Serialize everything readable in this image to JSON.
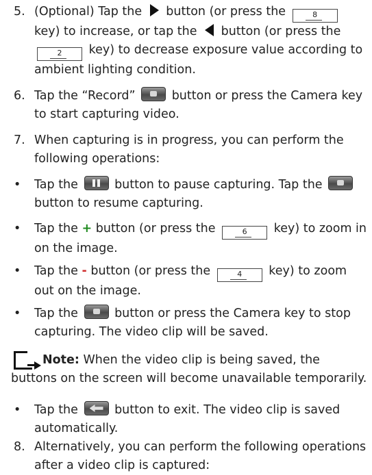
{
  "items": {
    "step5": {
      "num": "5.",
      "t1": "(Optional) Tap the",
      "t2": "button (or press the",
      "key_inc": "8",
      "t3": "key) to increase, or tap the",
      "t4": "button (or press the",
      "key_dec": "2",
      "t5": "key) to decrease exposure value according to ambient lighting condition."
    },
    "step6": {
      "num": "6.",
      "t1": "Tap the “Record”",
      "t2": "button or press the Camera key to start capturing video."
    },
    "step7": {
      "num": "7.",
      "text": "When capturing is in progress, you can perform the following operations:"
    },
    "bullet_pause": {
      "t1": "Tap the",
      "t2": "button to pause capturing. Tap the",
      "t3": "button to resume capturing."
    },
    "bullet_zoom_in": {
      "t1": "Tap the",
      "sym": "+",
      "t2": "button (or press the",
      "key": "6",
      "t3": "key) to zoom in on the image."
    },
    "bullet_zoom_out": {
      "t1": "Tap the",
      "sym": "-",
      "t2": "button (or press the",
      "key": "4",
      "t3": "key) to zoom out on the image."
    },
    "bullet_stop": {
      "t1": "Tap the",
      "t2": "button or press the Camera key to stop capturing. The video clip will be saved."
    },
    "note": {
      "label": "Note:",
      "text": "When the video clip is being saved, the buttons on the screen will become unavailable temporarily."
    },
    "bullet_exit": {
      "t1": "Tap the",
      "t2": "button to exit. The video clip is saved automatically."
    },
    "step8": {
      "num": "8.",
      "text": "Alternatively, you can perform the following operations after a video clip is captured:"
    }
  },
  "bullet_char": "•",
  "icons": {
    "increase": "right-triangle-icon",
    "decrease": "left-triangle-icon",
    "record": "record-button-icon",
    "pause": "pause-button-icon",
    "stop": "stop-button-icon",
    "exit": "back-arrow-button-icon",
    "note": "note-icon"
  }
}
